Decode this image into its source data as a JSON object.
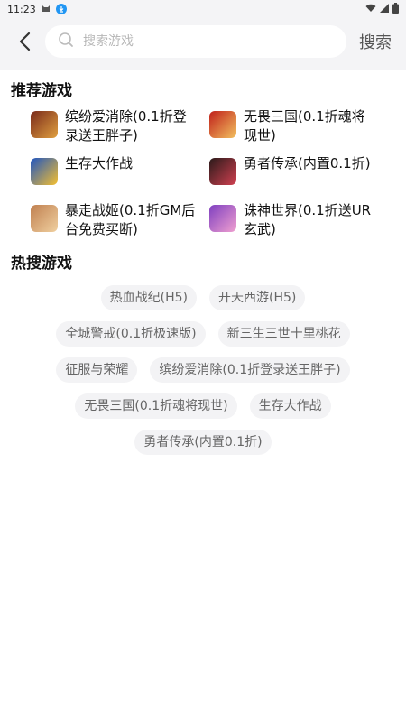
{
  "status": {
    "time": "11:23"
  },
  "search": {
    "placeholder": "搜索游戏",
    "value": "",
    "button_label": "搜索"
  },
  "recommended": {
    "title": "推荐游戏",
    "games": [
      {
        "name": "缤纷爱消除(0.1折登录送王胖子)",
        "icon_colors": [
          "#7a2a1a",
          "#e0a040"
        ]
      },
      {
        "name": "无畏三国(0.1折魂将现世)",
        "icon_colors": [
          "#c0201a",
          "#f2c060"
        ]
      },
      {
        "name": "生存大作战",
        "icon_colors": [
          "#1f55c0",
          "#f5c030"
        ]
      },
      {
        "name": "勇者传承(内置0.1折)",
        "icon_colors": [
          "#2a1a1a",
          "#d04050"
        ]
      },
      {
        "name": "暴走战姬(0.1折GM后台免费买断)",
        "icon_colors": [
          "#c08050",
          "#f0d0a0"
        ]
      },
      {
        "name": "诛神世界(0.1折送UR玄武)",
        "icon_colors": [
          "#8040c0",
          "#f0a0d0"
        ]
      }
    ]
  },
  "hot": {
    "title": "热搜游戏",
    "tags": [
      "热血战纪(H5)",
      "开天西游(H5)",
      "全城警戒(0.1折极速版)",
      "新三生三世十里桃花",
      "征服与荣耀",
      "缤纷爱消除(0.1折登录送王胖子)",
      "无畏三国(0.1折魂将现世)",
      "生存大作战",
      "勇者传承(内置0.1折)"
    ]
  }
}
